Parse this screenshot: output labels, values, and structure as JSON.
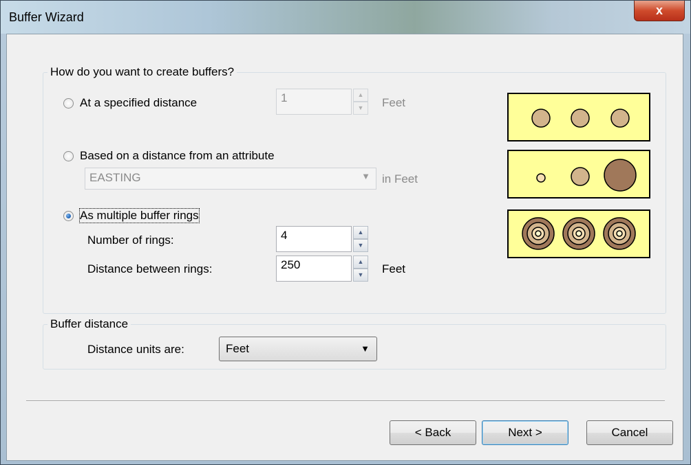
{
  "window": {
    "title": "Buffer Wizard",
    "close_glyph": "x"
  },
  "create_group": {
    "title": "How do you want to create buffers?",
    "option_distance": {
      "label": "At a specified distance",
      "checked": false,
      "value": "1",
      "unit": "Feet"
    },
    "option_attribute": {
      "label": "Based on a distance from an attribute",
      "checked": false,
      "field": "EASTING",
      "unit": "in Feet"
    },
    "option_rings": {
      "label": "As multiple buffer rings",
      "checked": true,
      "rings_label": "Number of rings:",
      "rings_value": "4",
      "distance_label": "Distance between rings:",
      "distance_value": "250",
      "unit": "Feet"
    }
  },
  "buffer_group": {
    "title": "Buffer distance",
    "units_label": "Distance units are:",
    "units_value": "Feet"
  },
  "buttons": {
    "back": "< Back",
    "next": "Next >",
    "cancel": "Cancel"
  },
  "colors": {
    "preview_bg": "#ffff99",
    "circle_fill": "#d2b48c",
    "circle_dark": "#a0785a"
  }
}
